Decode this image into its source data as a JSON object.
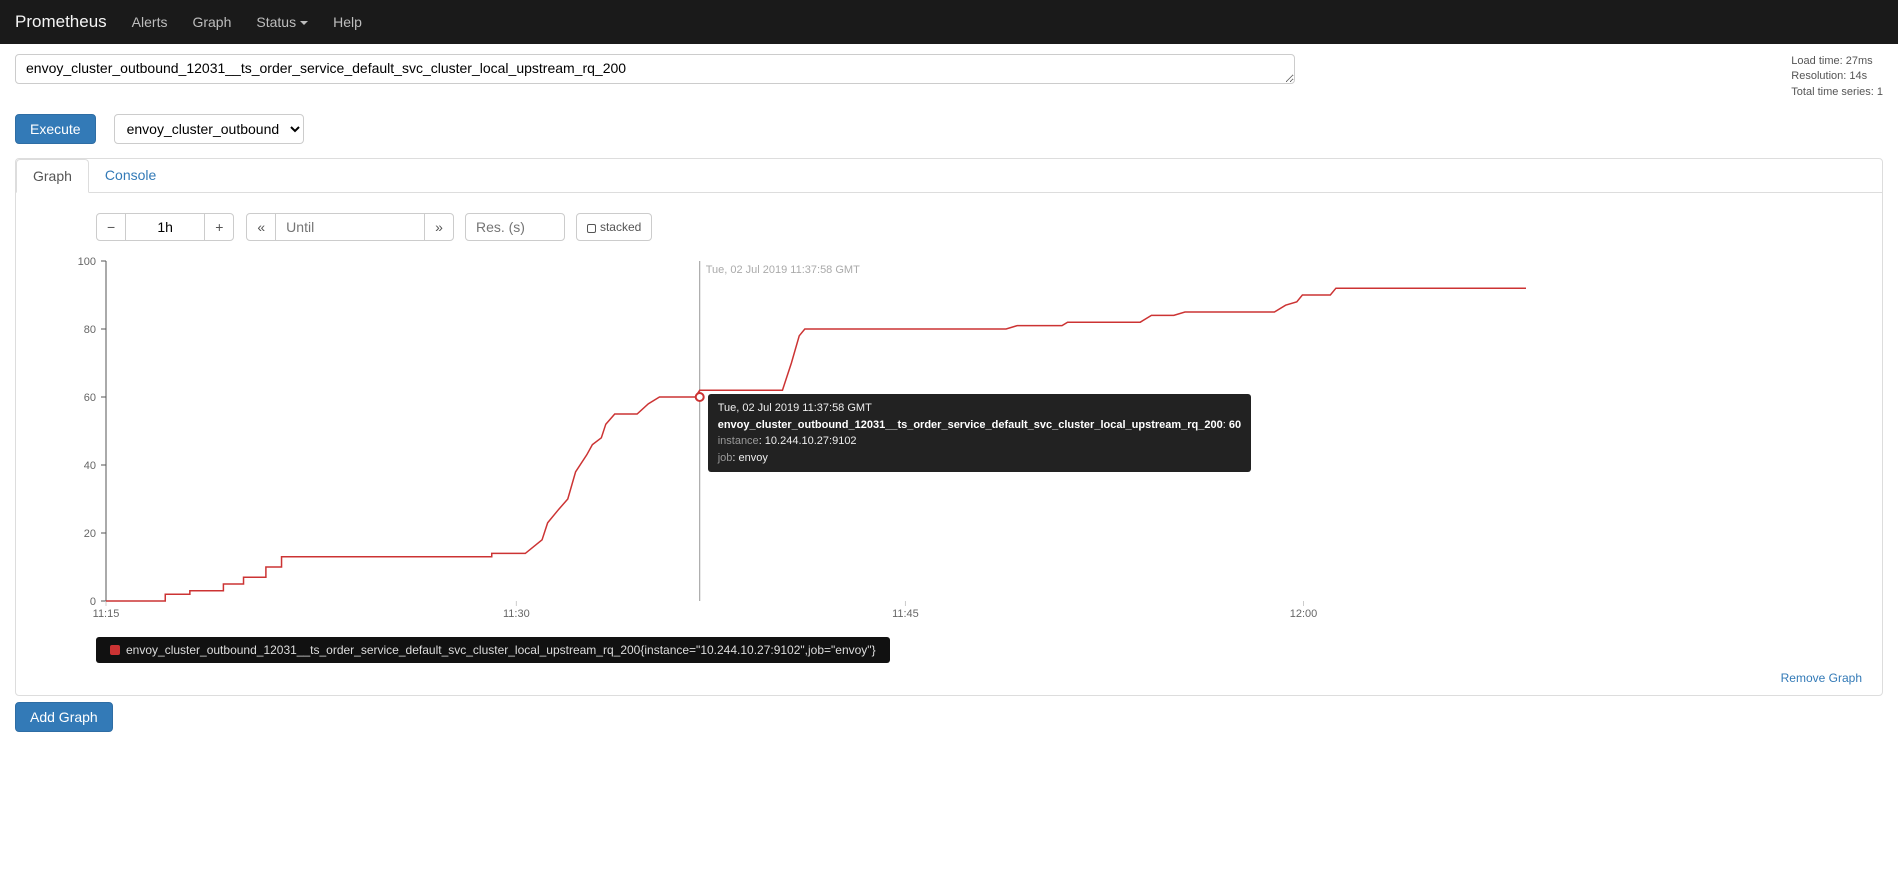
{
  "nav": {
    "brand": "Prometheus",
    "items": [
      "Alerts",
      "Graph",
      "Status",
      "Help"
    ]
  },
  "expression": "envoy_cluster_outbound_12031__ts_order_service_default_svc_cluster_local_upstream_rq_200",
  "loadinfo": {
    "load": "Load time: 27ms",
    "res": "Resolution: 14s",
    "series": "Total time series: 1"
  },
  "execute_label": "Execute",
  "metric_select": "envoy_cluster_outbound_",
  "tabs": {
    "graph": "Graph",
    "console": "Console"
  },
  "toolbar": {
    "minus": "−",
    "range": "1h",
    "plus": "+",
    "left": "«",
    "until": "Until",
    "right": "»",
    "res": "Res. (s)",
    "stacked": "stacked"
  },
  "chart_data": {
    "type": "line",
    "ylim": [
      0,
      100
    ],
    "yticks": [
      0,
      20,
      40,
      60,
      80,
      100
    ],
    "xticks_labels": [
      "11:15",
      "11:30",
      "11:45",
      "12:00"
    ],
    "xticks_x": [
      225,
      592,
      940,
      1296
    ],
    "hover_time": "Tue, 02 Jul 2019 11:37:58 GMT",
    "hover_value": "60",
    "hover_instance": "10.244.10.27:9102",
    "hover_job": "envoy",
    "hover_x": 756,
    "series_name": "envoy_cluster_outbound_12031__ts_order_service_default_svc_cluster_local_upstream_rq_200",
    "legend_text": "envoy_cluster_outbound_12031__ts_order_service_default_svc_cluster_local_upstream_rq_200{instance=\"10.244.10.27:9102\",job=\"envoy\"}",
    "points": [
      [
        225,
        0
      ],
      [
        278,
        0
      ],
      [
        278,
        2
      ],
      [
        300,
        2
      ],
      [
        300,
        3
      ],
      [
        330,
        3
      ],
      [
        330,
        5
      ],
      [
        348,
        5
      ],
      [
        348,
        7
      ],
      [
        368,
        7
      ],
      [
        368,
        10
      ],
      [
        382,
        10
      ],
      [
        382,
        13
      ],
      [
        570,
        13
      ],
      [
        570,
        14
      ],
      [
        600,
        14
      ],
      [
        615,
        18
      ],
      [
        620,
        23
      ],
      [
        630,
        27
      ],
      [
        638,
        30
      ],
      [
        645,
        38
      ],
      [
        655,
        43
      ],
      [
        660,
        46
      ],
      [
        668,
        48
      ],
      [
        672,
        52
      ],
      [
        680,
        55
      ],
      [
        700,
        55
      ],
      [
        710,
        58
      ],
      [
        720,
        60
      ],
      [
        752,
        60
      ],
      [
        756,
        62
      ],
      [
        830,
        62
      ],
      [
        838,
        70
      ],
      [
        845,
        78
      ],
      [
        850,
        80
      ],
      [
        1030,
        80
      ],
      [
        1040,
        81
      ],
      [
        1080,
        81
      ],
      [
        1085,
        82
      ],
      [
        1150,
        82
      ],
      [
        1160,
        84
      ],
      [
        1180,
        84
      ],
      [
        1190,
        85
      ],
      [
        1270,
        85
      ],
      [
        1280,
        87
      ],
      [
        1290,
        88
      ],
      [
        1295,
        90
      ],
      [
        1320,
        90
      ],
      [
        1325,
        92
      ],
      [
        1495,
        92
      ]
    ]
  },
  "remove_label": "Remove Graph",
  "add_label": "Add Graph"
}
